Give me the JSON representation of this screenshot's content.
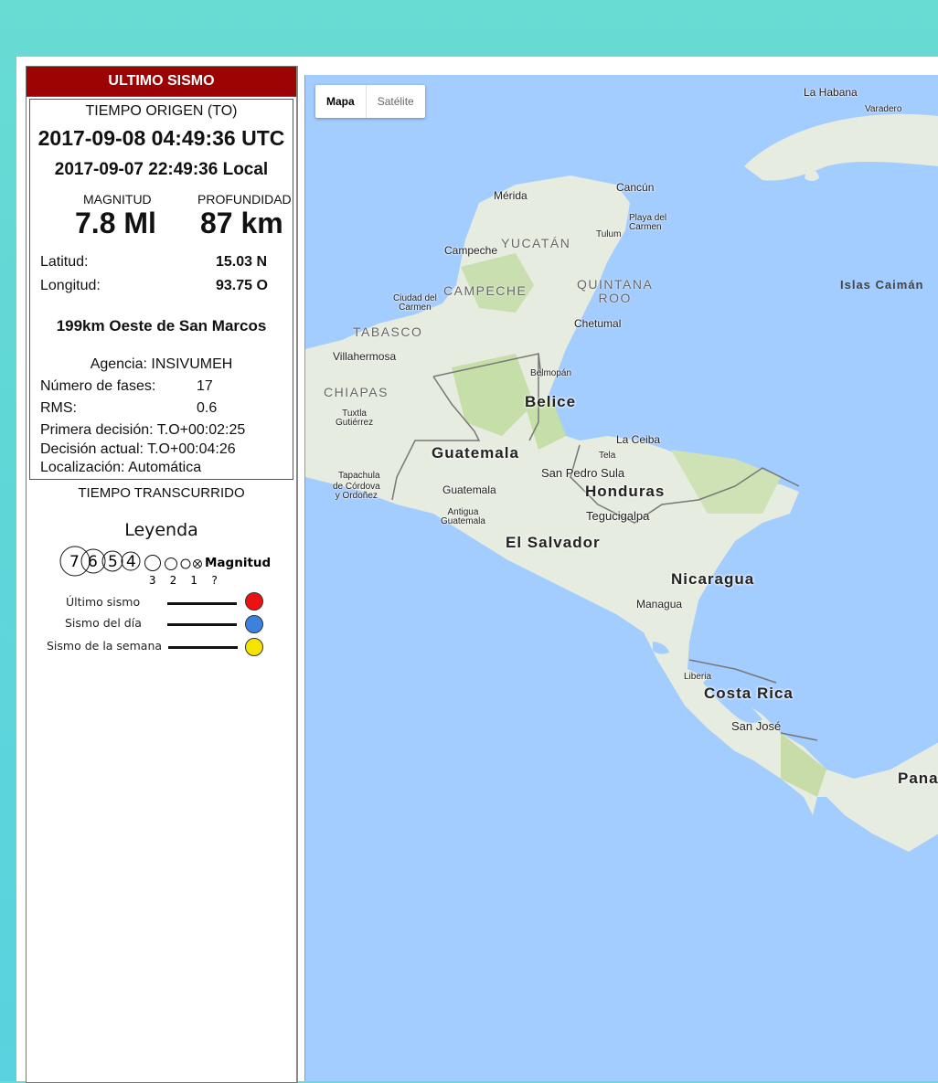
{
  "panel": {
    "header": "ULTIMO SISMO",
    "origin_label": "TIEMPO ORIGEN (TO)",
    "utc_time": "2017-09-08 04:49:36 UTC",
    "local_time": "2017-09-07 22:49:36 Local",
    "magnitude_label": "MAGNITUD",
    "depth_label": "PROFUNDIDAD",
    "magnitude_value": "7.8 Ml",
    "depth_value": "87 km",
    "latitude_label": "Latitud:",
    "latitude_value": "15.03 N",
    "longitude_label": "Longitud:",
    "longitude_value": "93.75 O",
    "location_text": "199km Oeste de San Marcos",
    "agency": "Agencia: INSIVUMEH",
    "phases_label": "Número de fases:",
    "phases_value": "17",
    "rms_label": "RMS:",
    "rms_value": "0.6",
    "first_decision": "Primera decisión: T.O+00:02:25",
    "current_decision": "Decisión actual: T.O+00:04:26",
    "localization": "Localización: Automática",
    "elapsed_label": "TIEMPO TRANSCURRIDO"
  },
  "legend": {
    "title": "Leyenda",
    "magnitude_word": "Magnitud",
    "big_digits": [
      "7",
      "6",
      "5",
      "4"
    ],
    "small_digits": "3  2  1  ?",
    "rows": [
      {
        "label": "Último sismo",
        "color": "#ee1111"
      },
      {
        "label": "Sismo del día",
        "color": "#3b82e0"
      },
      {
        "label": "Sismo de la semana",
        "color": "#f5e400"
      }
    ]
  },
  "map": {
    "type_buttons": [
      "Mapa",
      "Satélite"
    ],
    "active_type": "Mapa",
    "water_color": "#a3ccff",
    "land_color": "#e8ede3",
    "labels": {
      "la_habana": "La Habana",
      "varadero": "Varadero",
      "merida": "Mérida",
      "cancun": "Cancún",
      "playa": "Playa del\nCarmen",
      "tulum": "Tulum",
      "yucatan": "YUCATÁN",
      "campeche_city": "Campeche",
      "campeche_state": "CAMPECHE",
      "quintana": "QUINTANA\nROO",
      "islas_caiman": "Islas Caimán",
      "ciudad_carmen": "Ciudad del\nCarmen",
      "chetumal": "Chetumal",
      "tabasco": "TABASCO",
      "villahermosa": "Villahermosa",
      "belmopan": "Belmopán",
      "belice": "Belice",
      "chiapas": "CHIAPAS",
      "tuxtla": "Tuxtla\nGutiérrez",
      "guatemala_country": "Guatemala",
      "la_ceiba": "La Ceiba",
      "tela": "Tela",
      "san_pedro_sula": "San Pedro Sula",
      "tapachula": "Tapachula",
      "cordova": "de Córdova\ny Ordoñez",
      "guatemala_city": "Guatemala",
      "antigua": "Antigua\nGuatemala",
      "honduras": "Honduras",
      "tegucigalpa": "Tegucigalpa",
      "el_salvador": "El Salvador",
      "nicaragua": "Nicaragua",
      "managua": "Managua",
      "liberia": "Liberia",
      "costa_rica": "Costa Rica",
      "san_jose": "San José",
      "panama": "Pana"
    }
  }
}
